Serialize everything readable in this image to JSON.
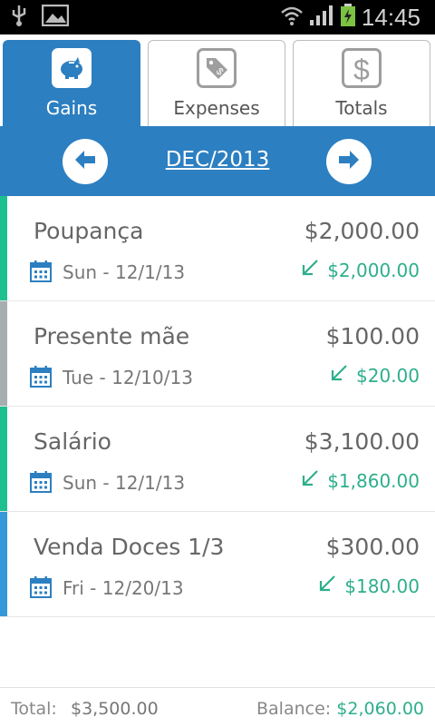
{
  "statusbar": {
    "time": "14:45"
  },
  "tabs": [
    {
      "label": "Gains",
      "active": true
    },
    {
      "label": "Expenses",
      "active": false
    },
    {
      "label": "Totals",
      "active": false
    }
  ],
  "month": "DEC/2013",
  "items": [
    {
      "name": "Poupança",
      "amount": "$2,000.00",
      "date": "Sun - 12/1/13",
      "paid": "$2,000.00",
      "color": "#1fc08f"
    },
    {
      "name": "Presente mãe",
      "amount": "$100.00",
      "date": "Tue - 12/10/13",
      "paid": "$20.00",
      "color": "#a7aeb0"
    },
    {
      "name": "Salário",
      "amount": "$3,100.00",
      "date": "Sun - 12/1/13",
      "paid": "$1,860.00",
      "color": "#1fc08f"
    },
    {
      "name": "Venda Doces 1/3",
      "amount": "$300.00",
      "date": "Fri - 12/20/13",
      "paid": "$180.00",
      "color": "#3498db"
    }
  ],
  "footer": {
    "total_label": "Total:",
    "total_value": "$3,500.00",
    "balance_label": "Balance:",
    "balance_value": "$2,060.00"
  },
  "colors": {
    "primary": "#2c7fc1",
    "positive": "#2eaf8c"
  }
}
